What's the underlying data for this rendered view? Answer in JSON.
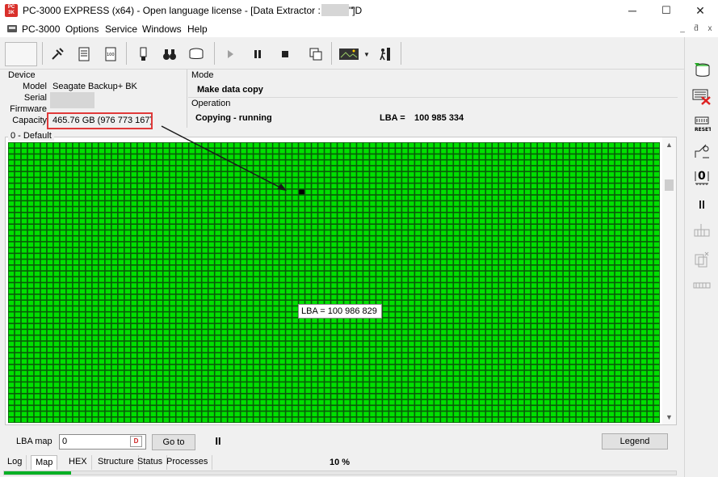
{
  "window": {
    "title": "PC-3000 EXPRESS (x64) - Open language license - [Data Extractor : Task - \"D",
    "title_tail": "\"]",
    "controls": {
      "minimize": "─",
      "maximize": "☐",
      "close": "✕"
    }
  },
  "menubar": {
    "items": [
      "PC-3000",
      "Options",
      "Service",
      "Windows",
      "Help"
    ],
    "mdi_controls": [
      "_",
      "ƌ",
      "x"
    ]
  },
  "device": {
    "heading": "Device",
    "model_label": "Model",
    "model": "Seagate Backup+ BK",
    "serial_label": "Serial",
    "firmware_label": "Firmware",
    "capacity_label": "Capacity",
    "capacity": "465.76 GB (976 773 167)"
  },
  "mode": {
    "heading": "Mode",
    "value": "Make data copy"
  },
  "operation": {
    "heading": "Operation",
    "status": "Copying - running",
    "lba_label": "LBA =",
    "lba_value": "100 985 334"
  },
  "map": {
    "caption": "0 - Default",
    "cell_color": "#00e000",
    "cell_border": "#0a5a0a",
    "current_color": "#000000",
    "tooltip": "LBA =  100 986 829"
  },
  "bottom": {
    "lba_map_label": "LBA map",
    "lba_input_value": "0",
    "goto_label": "Go to",
    "pause_label": "II",
    "legend_label": "Legend",
    "tabs": [
      "Log",
      "Map",
      "HEX",
      "Structure",
      "Status",
      "Processes"
    ],
    "active_tab": "Map",
    "percent": "10 %",
    "progress": 0.1
  },
  "colors": {
    "annotation_red": "#e03a3a",
    "progress_green": "#06b025"
  },
  "toolbar_icons": [
    "tools-icon",
    "passport-icon",
    "sector-copy-icon",
    "percent-doc-icon",
    "usb-icon",
    "binoculars-icon",
    "disk-icon",
    "play-icon",
    "pause-icon",
    "stop-icon",
    "copy-icon",
    "image-icon",
    "exit-icon"
  ],
  "right_toolbar_icons": [
    "database-icon",
    "power-off-icon",
    "reset-icon",
    "sleep-icon",
    "zero-icon",
    "pause-icon",
    "grid-icon",
    "copy-icon",
    "connector-icon"
  ]
}
